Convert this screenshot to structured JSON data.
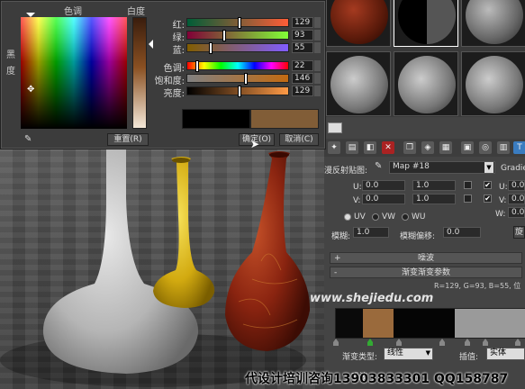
{
  "dialog": {
    "hue_label": "色调",
    "whiteness_label": "白度",
    "blackness_label": "黑\n度",
    "rows": [
      {
        "label": "红:",
        "value": "129",
        "fraction": 0.51
      },
      {
        "label": "绿:",
        "value": "93",
        "fraction": 0.36
      },
      {
        "label": "蓝:",
        "value": "55",
        "fraction": 0.22
      },
      {
        "label": "色调:",
        "value": "22",
        "fraction": 0.09
      },
      {
        "label": "饱和度:",
        "value": "146",
        "fraction": 0.57
      },
      {
        "label": "亮度:",
        "value": "129",
        "fraction": 0.51
      }
    ],
    "reset_label": "重置(R)",
    "ok_label": "确定(O)",
    "cancel_label": "取消(C)",
    "old_color": "#000000",
    "new_color": "#815d37"
  },
  "panel": {
    "map_label": "漫反射贴图:",
    "map_name": "Map #18",
    "gradient_label": "Gradie",
    "u_label": "U:",
    "v_label": "V:",
    "w_label": "W:",
    "offset_u": "0.0",
    "offset_v": "0.0",
    "tiling_u": "1.0",
    "tiling_v": "1.0",
    "angle_u": "0.0",
    "angle_v": "0.0",
    "angle_w": "0.0",
    "uv_label": "UV",
    "vw_label": "VW",
    "wu_label": "WU",
    "blur_label": "模糊:",
    "blur_value": "1.0",
    "blur_offset_label": "模糊偏移:",
    "blur_offset_value": "0.0",
    "rotate_label": "旋",
    "noise_rollout": "噪波",
    "gradient_params_rollout": "渐变渐变参数",
    "rgb_info": "R=129, G=93, B=55, 位",
    "gradient_type_label": "渐变类型:",
    "gradient_type_value": "线性",
    "interpolation_label": "插值:",
    "interpolation_value": "实体",
    "noise_label": "噪波"
  },
  "watermark": "www.shejiedu.com",
  "footer": "代设计培训咨询13903833301 QQ158787"
}
